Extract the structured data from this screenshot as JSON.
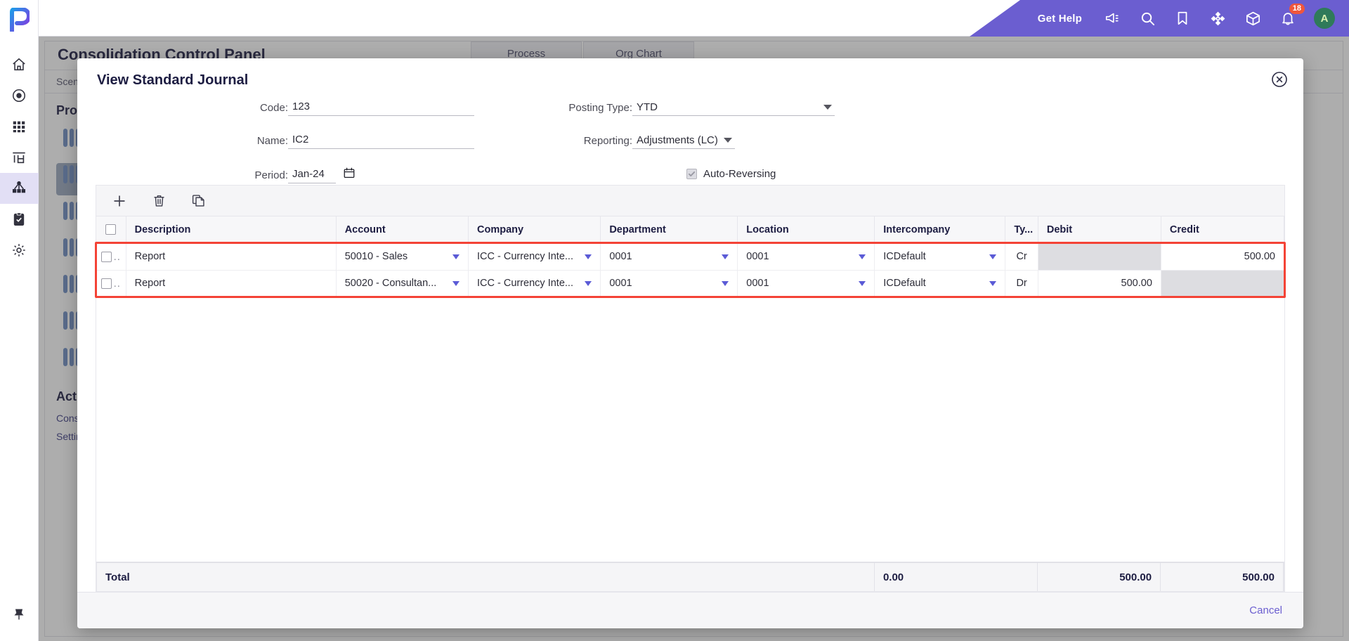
{
  "app": {
    "logo": "p-logo-icon",
    "rail_items": [
      {
        "name": "home-icon",
        "active": false
      },
      {
        "name": "target-icon",
        "active": false
      },
      {
        "name": "grid-apps-icon",
        "active": false
      },
      {
        "name": "table-chart-icon",
        "active": false
      },
      {
        "name": "hierarchy-icon",
        "active": true
      },
      {
        "name": "clipboard-check-icon",
        "active": false
      },
      {
        "name": "gear-icon",
        "active": false
      }
    ],
    "rail_bottom": {
      "name": "pin-icon"
    }
  },
  "topbar": {
    "get_help": "Get Help",
    "icons": [
      "megaphone-icon",
      "search-icon",
      "bookmark-icon",
      "target-crosshair-icon",
      "cube-icon",
      "bell-icon"
    ],
    "notification_count": "18",
    "avatar_initial": "A",
    "accent_color": "#6b5ed0",
    "badge_color": "#f0563c"
  },
  "background": {
    "page_title": "Consolidation Control Panel",
    "buttons": [
      "Process",
      "Org Chart"
    ],
    "subbar": "Scenario",
    "section_title": "Process",
    "links": [
      "Consolidation",
      "Settings"
    ],
    "action_title": "Actions"
  },
  "modal": {
    "title": "View Standard Journal",
    "close_icon": "close-circle-icon",
    "fields": {
      "code_label": "Code:",
      "code_value": "123",
      "name_label": "Name:",
      "name_value": "IC2",
      "period_label": "Period:",
      "period_value": "Jan-24",
      "period_icon": "calendar-icon",
      "posting_type_label": "Posting Type:",
      "posting_type_value": "YTD",
      "reporting_label": "Reporting:",
      "reporting_value": "Adjustments (LC)",
      "auto_reversing_label": "Auto-Reversing",
      "auto_reversing_checked": true,
      "auto_reversing_disabled": true
    },
    "toolbar": [
      {
        "name": "add-row-button",
        "icon": "plus-icon"
      },
      {
        "name": "delete-row-button",
        "icon": "trash-icon"
      },
      {
        "name": "copy-row-button",
        "icon": "copy-icon"
      }
    ],
    "table": {
      "columns": [
        {
          "key": "check",
          "label": ""
        },
        {
          "key": "description",
          "label": "Description"
        },
        {
          "key": "account",
          "label": "Account"
        },
        {
          "key": "company",
          "label": "Company"
        },
        {
          "key": "department",
          "label": "Department"
        },
        {
          "key": "location",
          "label": "Location"
        },
        {
          "key": "intercompany",
          "label": "Intercompany"
        },
        {
          "key": "type",
          "label": "Ty..."
        },
        {
          "key": "debit",
          "label": "Debit"
        },
        {
          "key": "credit",
          "label": "Credit"
        }
      ],
      "rows": [
        {
          "description": "Report",
          "account": "50010 - Sales",
          "company": "ICC - Currency Inte...",
          "department": "0001",
          "location": "0001",
          "intercompany": "ICDefault",
          "type": "Cr",
          "debit": "",
          "credit": "500.00",
          "debit_disabled": true,
          "credit_disabled": false
        },
        {
          "description": "Report",
          "account": "50020 - Consultan...",
          "company": "ICC - Currency Inte...",
          "department": "0001",
          "location": "0001",
          "intercompany": "ICDefault",
          "type": "Dr",
          "debit": "500.00",
          "credit": "",
          "debit_disabled": false,
          "credit_disabled": true
        }
      ],
      "totals": {
        "label": "Total",
        "type": "0.00",
        "debit": "500.00",
        "credit": "500.00"
      },
      "highlight_color": "#f44336"
    },
    "footer": {
      "cancel_label": "Cancel"
    }
  }
}
